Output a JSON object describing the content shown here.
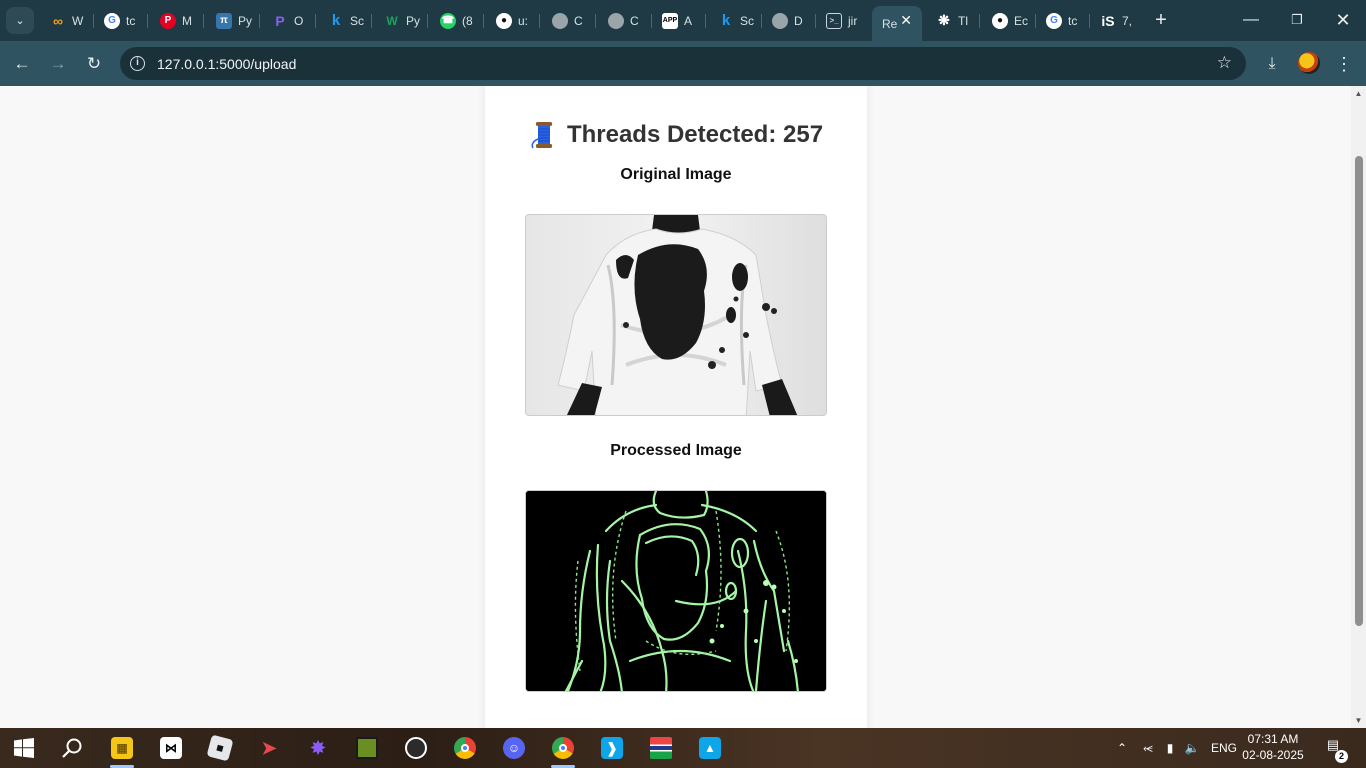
{
  "browser": {
    "tabs": [
      {
        "label": "W",
        "icon": "infinity-icon",
        "color": "#f59e0b"
      },
      {
        "label": "tc",
        "icon": "google-icon",
        "color": "#4285f4"
      },
      {
        "label": "M",
        "icon": "pinterest-icon",
        "color": "#e60023"
      },
      {
        "label": "Py",
        "icon": "python-icon",
        "color": "#3776ab"
      },
      {
        "label": "O",
        "icon": "p-logo-icon",
        "color": "#7c3aed"
      },
      {
        "label": "Sc",
        "icon": "k-logo-icon",
        "color": "#1d9bf0"
      },
      {
        "label": "Py",
        "icon": "w-logo-icon",
        "color": "#1aa260"
      },
      {
        "label": "(8",
        "icon": "whatsapp-icon",
        "color": "#25d366"
      },
      {
        "label": "u:",
        "icon": "github-icon",
        "color": "#ffffff"
      },
      {
        "label": "C",
        "icon": "globe-icon",
        "color": "#9aa5a9"
      },
      {
        "label": "C",
        "icon": "globe-icon",
        "color": "#9aa5a9"
      },
      {
        "label": "A",
        "icon": "app-icon",
        "color": "#ffffff"
      },
      {
        "label": "Sc",
        "icon": "k-logo-icon",
        "color": "#1d9bf0"
      },
      {
        "label": "D",
        "icon": "globe-icon",
        "color": "#9aa5a9"
      },
      {
        "label": "jir",
        "icon": "terminal-icon",
        "color": "#cbd5e1"
      },
      {
        "label": "Re",
        "icon": "page-icon",
        "color": "#ffffff",
        "active": true
      },
      {
        "label": "Tl",
        "icon": "openai-icon",
        "color": "#ffffff"
      },
      {
        "label": "Ec",
        "icon": "github-icon",
        "color": "#ffffff"
      },
      {
        "label": "tc",
        "icon": "google-icon",
        "color": "#4285f4"
      },
      {
        "label": "7,",
        "icon": "is-logo-icon",
        "color": "#ffffff"
      }
    ],
    "new_tab": "+",
    "url": "127.0.0.1:5000/upload"
  },
  "page": {
    "headline": "Threads Detected: 257",
    "headline_icon": "thread-spool-icon",
    "original_label": "Original Image",
    "processed_label": "Processed Image"
  },
  "taskbar": {
    "apps": [
      {
        "name": "windows-start",
        "color": "#ffffff"
      },
      {
        "name": "search",
        "color": "#ffffff"
      },
      {
        "name": "file-explorer",
        "color": "#f5c518"
      },
      {
        "name": "capcut",
        "color": "#ffffff"
      },
      {
        "name": "roblox",
        "color": "#ffffff"
      },
      {
        "name": "flutterflow",
        "color": "#e5484d"
      },
      {
        "name": "network-app",
        "color": "#8b5cf6"
      },
      {
        "name": "minecraft",
        "color": "#6b8e23"
      },
      {
        "name": "obs-studio",
        "color": "#ffffff"
      },
      {
        "name": "chrome",
        "color": "#4285f4"
      },
      {
        "name": "discord",
        "color": "#5865f2"
      },
      {
        "name": "chrome-profile",
        "color": "#4285f4"
      },
      {
        "name": "vscode",
        "color": "#0ea5e9"
      },
      {
        "name": "flag-app",
        "color": "#ef4444"
      },
      {
        "name": "photos",
        "color": "#0ea5e9"
      }
    ],
    "language": "ENG",
    "time": "07:31 AM",
    "date": "02-08-2025",
    "notifications": "2"
  }
}
